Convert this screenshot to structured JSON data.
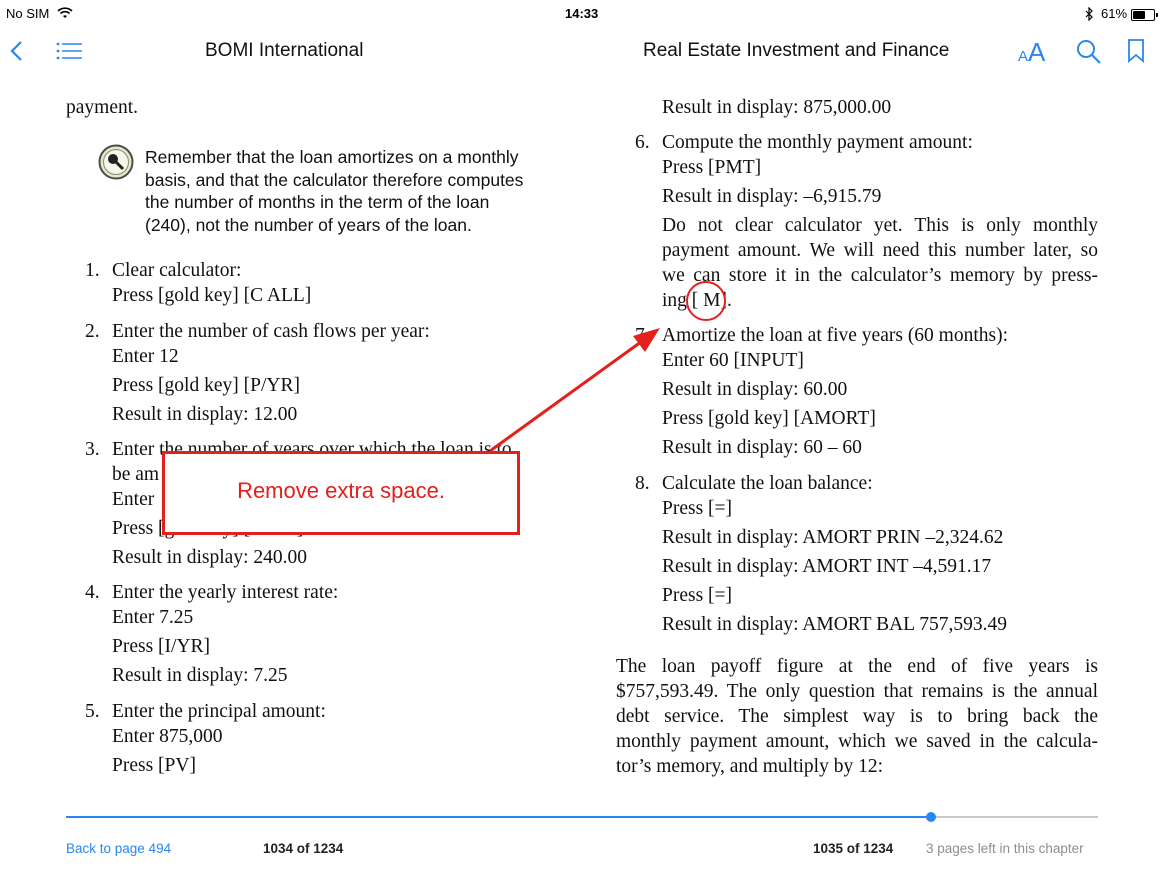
{
  "status_bar": {
    "carrier": "No SIM",
    "time": "14:33",
    "battery": "61%",
    "battery_level": 0.61
  },
  "nav": {
    "left_title": "BOMI International",
    "right_title": "Real Estate Investment and Finance",
    "font_button_label": "AA"
  },
  "left_page": {
    "top_line": "payment.",
    "note_lines": [
      "Remember that the loan amortizes on a monthly",
      "basis, and that the calculator therefore computes",
      "the number of months in the term of the loan",
      "(240), not the number of years of the loan."
    ],
    "steps": [
      {
        "number": "1.",
        "lines": [
          "Clear calculator:",
          "Press [gold key] [C ALL]"
        ]
      },
      {
        "number": "2.",
        "lines": [
          "Enter the number of cash flows per year:",
          "Enter 12",
          "Press [gold key] [P/YR]",
          "Result in display: 12.00"
        ]
      },
      {
        "number": "3.",
        "lines": [
          "Enter the number of years over which the loan is to",
          "be am",
          "Enter",
          "Press [gold key] [N/YR]",
          "Result in display: 240.00"
        ]
      },
      {
        "number": "4.",
        "lines": [
          "Enter the yearly interest rate:",
          "Enter 7.25",
          "Press [I/YR]",
          "Result in display: 7.25"
        ]
      },
      {
        "number": "5.",
        "lines": [
          "Enter the principal amount:",
          "Enter 875,000",
          "Press [PV]"
        ]
      }
    ]
  },
  "right_page": {
    "top_line": "Result in display: 875,000.00",
    "steps": [
      {
        "number": "6.",
        "lines": [
          "Compute the monthly payment amount:",
          "Press [PMT]",
          "Result in display: –6,915.79"
        ],
        "paragraph": [
          "Do not clear calculator yet. This is only monthly",
          "payment amount. We will need this number later, so",
          "we can store it in the calculator’s memory by press-",
          "ing [ M]."
        ]
      },
      {
        "number": "7.",
        "lines": [
          "Amortize the loan at five years (60 months):",
          "Enter 60 [INPUT]",
          "Result in display: 60.00",
          "Press [gold key] [AMORT]",
          "Result in display: 60 – 60"
        ]
      },
      {
        "number": "8.",
        "lines": [
          "Calculate the loan balance:",
          "Press [=]",
          "Result in display: AMORT PRIN –2,324.62",
          "Result in display: AMORT INT –4,591.17",
          "Press [=]",
          "Result in display: AMORT BAL 757,593.49"
        ]
      }
    ],
    "closing": [
      "The loan payoff figure at the end of five years is",
      "$757,593.49. The only question that remains is the annual",
      "debt service. The simplest way is to bring back the",
      "monthly payment amount, which we saved in the calcula-",
      "tor’s memory, and multiply by 12:"
    ]
  },
  "annotation": {
    "callout_text": "Remove extra space.",
    "color": "#e3201b"
  },
  "footer": {
    "back_link": "Back to page 494",
    "left_page_count": "1034 of 1234",
    "right_page_count": "1035 of 1234",
    "pages_left": "3 pages left in this chapter",
    "progress": 0.838
  },
  "colors": {
    "accent": "#2a86f3",
    "annotation": "#e3201b"
  },
  "icons": [
    "back-chevron-icon",
    "list-icon",
    "font-size-icon",
    "search-icon",
    "bookmark-icon",
    "key-note-icon",
    "wifi-icon",
    "bluetooth-icon",
    "battery-icon"
  ]
}
